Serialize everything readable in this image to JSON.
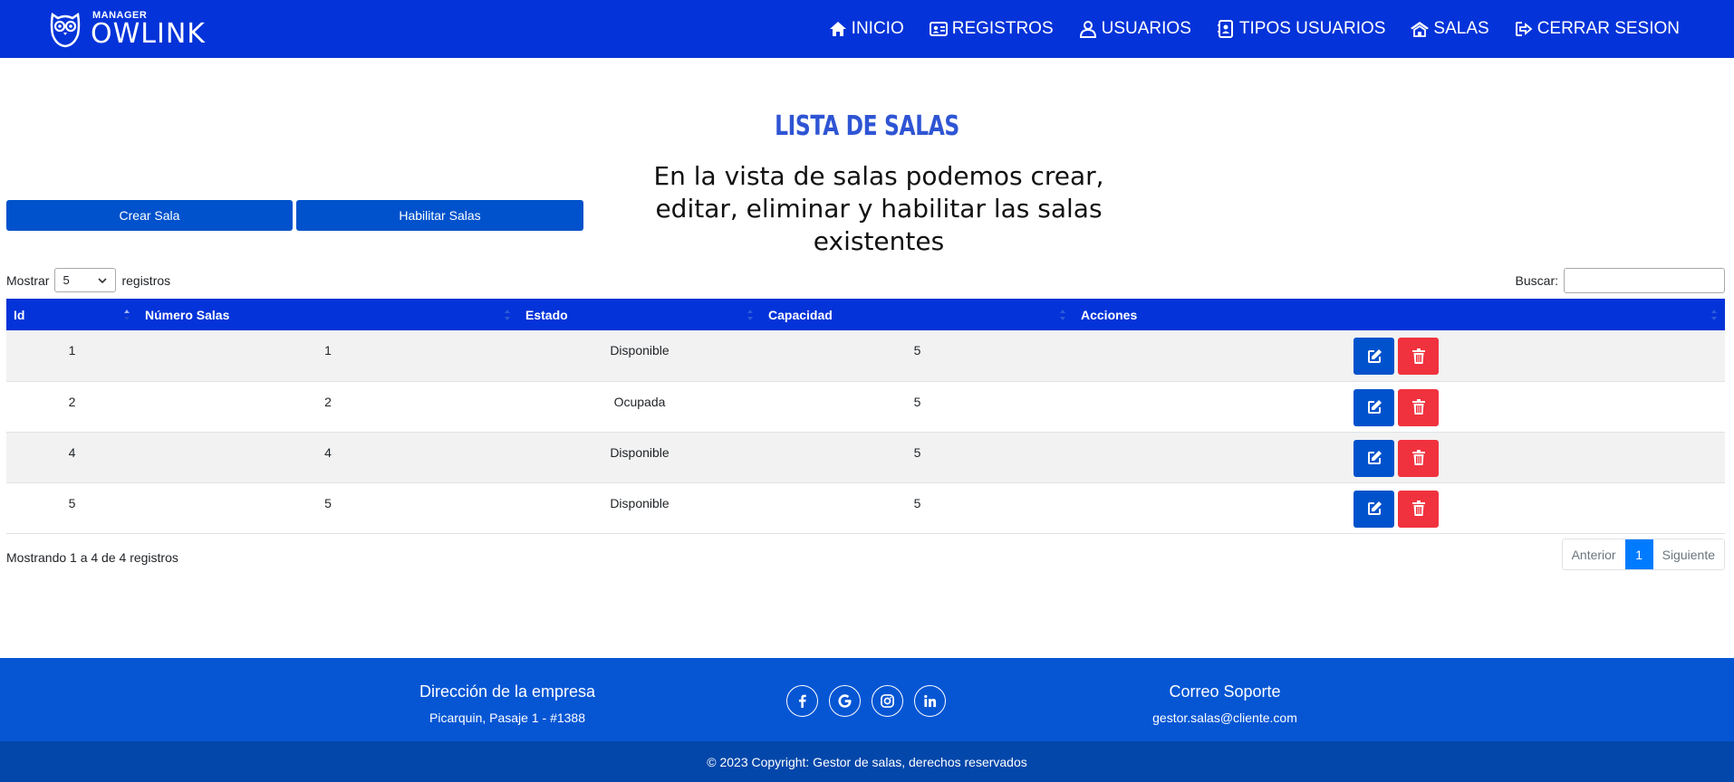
{
  "brand": {
    "small": "MANAGER",
    "big": "OWLINK",
    "logo_icon": "owl-icon"
  },
  "nav": [
    {
      "label": "INICIO",
      "icon": "home-icon"
    },
    {
      "label": "REGISTROS",
      "icon": "id-card-icon"
    },
    {
      "label": "USUARIOS",
      "icon": "user-icon"
    },
    {
      "label": "TIPOS USUARIOS",
      "icon": "address-book-icon"
    },
    {
      "label": "SALAS",
      "icon": "building-icon"
    },
    {
      "label": "CERRAR SESION",
      "icon": "sign-out-icon"
    }
  ],
  "header": {
    "title": "Lista de Salas",
    "description": "En la vista de salas podemos crear, editar, eliminar y habilitar las salas existentes"
  },
  "buttons": {
    "crear": "Crear Sala",
    "habilitar": "Habilitar Salas"
  },
  "datatable": {
    "length_prefix": "Mostrar",
    "length_value": "5",
    "length_suffix": "registros",
    "search_label": "Buscar:",
    "search_value": "",
    "columns": [
      "Id",
      "Número Salas",
      "Estado",
      "Capacidad",
      "Acciones"
    ],
    "rows": [
      {
        "id": "1",
        "numero": "1",
        "estado": "Disponible",
        "capacidad": "5"
      },
      {
        "id": "2",
        "numero": "2",
        "estado": "Ocupada",
        "capacidad": "5"
      },
      {
        "id": "4",
        "numero": "4",
        "estado": "Disponible",
        "capacidad": "5"
      },
      {
        "id": "5",
        "numero": "5",
        "estado": "Disponible",
        "capacidad": "5"
      }
    ],
    "info": "Mostrando 1 a 4 de 4 registros",
    "pagination": {
      "prev": "Anterior",
      "current": "1",
      "next": "Siguiente"
    }
  },
  "footer": {
    "address_heading": "Dirección de la empresa",
    "address": "Picarquin, Pasaje 1 - #1388",
    "support_heading": "Correo Soporte",
    "support_email": "gestor.salas@cliente.com",
    "socials": [
      "facebook-icon",
      "google-icon",
      "instagram-icon",
      "linkedin-icon"
    ],
    "copyright": "© 2023 Copyright: Gestor de salas, derechos reservados"
  },
  "colors": {
    "navbar": "#0433d9",
    "primary": "#0052cc",
    "danger": "#f0323e",
    "footer": "#0656d4",
    "footer_bottom": "#0447aa",
    "title": "#2f55d4"
  }
}
